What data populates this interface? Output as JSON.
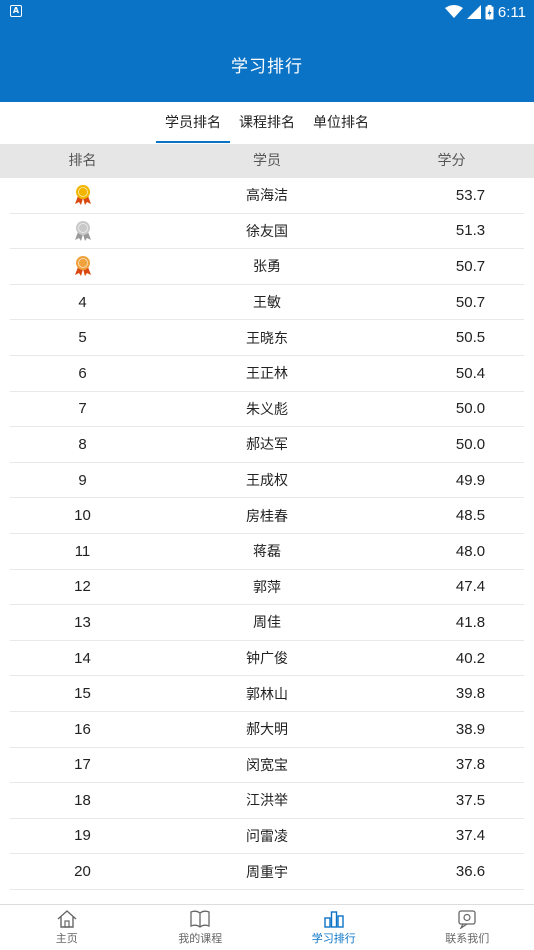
{
  "status_bar": {
    "time": "6:11",
    "app_icon": "A"
  },
  "header": {
    "title": "学习排行"
  },
  "tabs": [
    {
      "label": "学员排名",
      "active": true
    },
    {
      "label": "课程排名",
      "active": false
    },
    {
      "label": "单位排名",
      "active": false
    }
  ],
  "table": {
    "headers": {
      "rank": "排名",
      "name": "学员",
      "score": "学分"
    },
    "rows": [
      {
        "rank": "",
        "medal": "gold-medal-icon",
        "name": "高海洁",
        "score": "53.7"
      },
      {
        "rank": "",
        "medal": "silver-medal-icon",
        "name": "徐友国",
        "score": "51.3"
      },
      {
        "rank": "",
        "medal": "bronze-medal-icon",
        "name": "张勇",
        "score": "50.7"
      },
      {
        "rank": "4",
        "name": "王敏",
        "score": "50.7"
      },
      {
        "rank": "5",
        "name": "王晓东",
        "score": "50.5"
      },
      {
        "rank": "6",
        "name": "王正林",
        "score": "50.4"
      },
      {
        "rank": "7",
        "name": "朱义彪",
        "score": "50.0"
      },
      {
        "rank": "8",
        "name": "郝达军",
        "score": "50.0"
      },
      {
        "rank": "9",
        "name": "王成权",
        "score": "49.9"
      },
      {
        "rank": "10",
        "name": "房桂春",
        "score": "48.5"
      },
      {
        "rank": "11",
        "name": "蒋磊",
        "score": "48.0"
      },
      {
        "rank": "12",
        "name": "郭萍",
        "score": "47.4"
      },
      {
        "rank": "13",
        "name": "周佳",
        "score": "41.8"
      },
      {
        "rank": "14",
        "name": "钟广俊",
        "score": "40.2"
      },
      {
        "rank": "15",
        "name": "郭林山",
        "score": "39.8"
      },
      {
        "rank": "16",
        "name": "郝大明",
        "score": "38.9"
      },
      {
        "rank": "17",
        "name": "闵宽宝",
        "score": "37.8"
      },
      {
        "rank": "18",
        "name": "江洪举",
        "score": "37.5"
      },
      {
        "rank": "19",
        "name": "问雷凌",
        "score": "37.4"
      },
      {
        "rank": "20",
        "name": "周重宇",
        "score": "36.6"
      }
    ]
  },
  "bottom_nav": [
    {
      "label": "主页",
      "icon": "home-icon",
      "active": false
    },
    {
      "label": "我的课程",
      "icon": "book-icon",
      "active": false
    },
    {
      "label": "学习排行",
      "icon": "ranking-icon",
      "active": true
    },
    {
      "label": "联系我们",
      "icon": "chat-icon",
      "active": false
    }
  ],
  "colors": {
    "primary": "#0a73c6",
    "header_bg": "#e6e6e6"
  }
}
